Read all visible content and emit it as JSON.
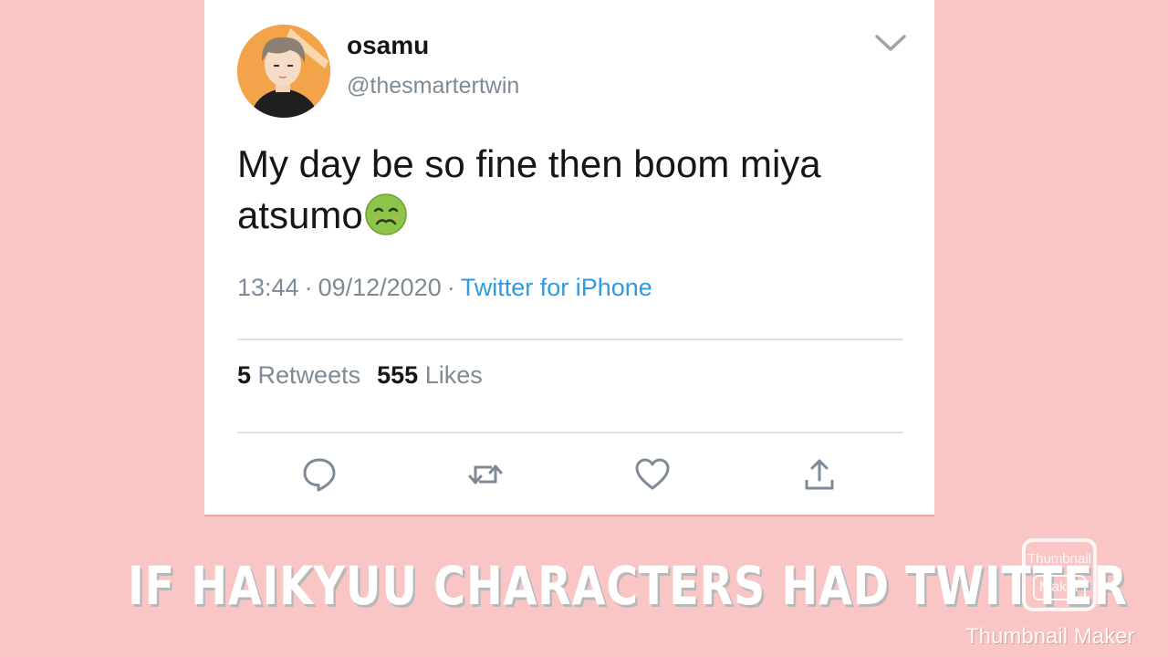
{
  "tweet": {
    "display_name": "osamu",
    "handle": "@thesmartertwin",
    "text": "My day be so fine then boom miya atsumo",
    "text_emoji": "nauseated-face-emoji",
    "time": "13:44",
    "date": "09/12/2020",
    "separator": "·",
    "source": "Twitter for iPhone",
    "retweets_count": "5",
    "retweets_label": "Retweets",
    "likes_count": "555",
    "likes_label": "Likes",
    "link_color": "#2f9ae3",
    "avatar_bg_color": "#f3a44a"
  },
  "icons": {
    "menu": "chevron-down-icon",
    "reply": "reply-icon",
    "retweet": "retweet-icon",
    "like": "heart-icon",
    "share": "share-icon"
  },
  "overlay": {
    "caption": "IF HAIKYUU CHARACTERS HAD TWITTER",
    "watermark_logo_line1": "Thumbnail",
    "watermark_logo_line2": "Maker",
    "watermark_text": "Thumbnail Maker"
  },
  "colors": {
    "background": "#f9c6c5",
    "card": "#ffffff",
    "muted_text": "#7e8a95"
  }
}
